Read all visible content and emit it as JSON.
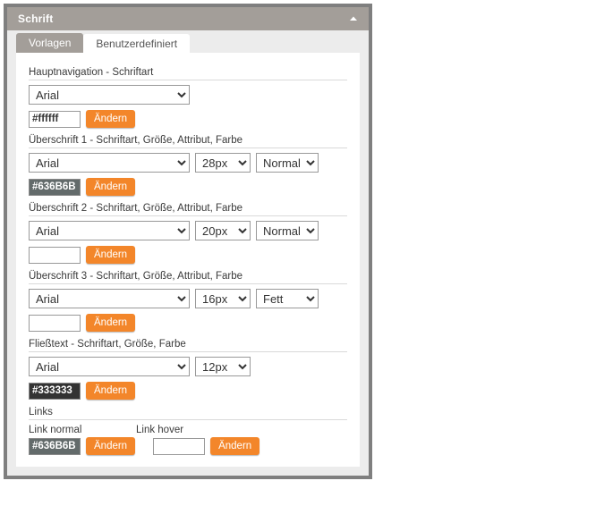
{
  "panel": {
    "title": "Schrift",
    "collapse_icon": "chevron-up-icon",
    "accent_color": "#f3862a",
    "titlebar_color": "#a39e99"
  },
  "tabs": [
    {
      "label": "Vorlagen",
      "active": false
    },
    {
      "label": "Benutzerdefiniert",
      "active": true
    }
  ],
  "sections": [
    {
      "label": "Hauptnavigation - Schriftart",
      "font": "Arial",
      "size": null,
      "attribute": null,
      "color_value": "#ffffff",
      "color_filled": false,
      "button": "Ändern"
    },
    {
      "label": "Überschrift 1 - Schriftart, Größe, Attribut, Farbe",
      "font": "Arial",
      "size": "28px",
      "attribute": "Normal",
      "color_value": "#636B6B",
      "color_filled": true,
      "button": "Ändern"
    },
    {
      "label": "Überschrift 2 - Schriftart, Größe, Attribut, Farbe",
      "font": "Arial",
      "size": "20px",
      "attribute": "Normal",
      "color_value": "",
      "color_filled": false,
      "button": "Ändern"
    },
    {
      "label": "Überschrift 3 - Schriftart, Größe, Attribut, Farbe",
      "font": "Arial",
      "size": "16px",
      "attribute": "Fett",
      "color_value": "",
      "color_filled": false,
      "button": "Ändern"
    },
    {
      "label": "Fließtext - Schriftart, Größe, Farbe",
      "font": "Arial",
      "size": "12px",
      "attribute": null,
      "color_value": "#333333",
      "color_filled": true,
      "button": "Ändern"
    }
  ],
  "links": {
    "label": "Links",
    "normal": {
      "label": "Link normal",
      "color_value": "#636B6B",
      "color_filled": true,
      "button": "Ändern"
    },
    "hover": {
      "label": "Link hover",
      "color_value": "",
      "color_filled": false,
      "button": "Ändern"
    }
  },
  "options": {
    "fonts": [
      "Arial"
    ],
    "sizes": [
      "12px",
      "16px",
      "20px",
      "28px"
    ],
    "attributes": [
      "Normal",
      "Fett"
    ]
  }
}
